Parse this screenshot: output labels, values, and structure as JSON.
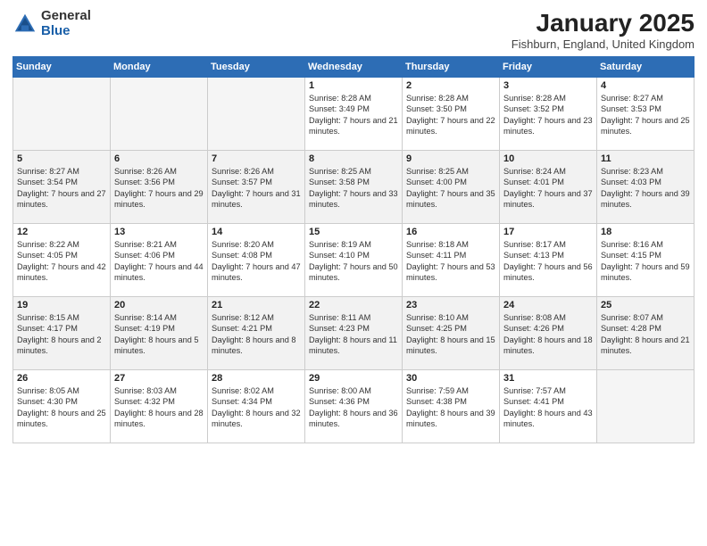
{
  "logo": {
    "general": "General",
    "blue": "Blue"
  },
  "title": "January 2025",
  "subtitle": "Fishburn, England, United Kingdom",
  "days_of_week": [
    "Sunday",
    "Monday",
    "Tuesday",
    "Wednesday",
    "Thursday",
    "Friday",
    "Saturday"
  ],
  "weeks": [
    [
      {
        "num": "",
        "info": ""
      },
      {
        "num": "",
        "info": ""
      },
      {
        "num": "",
        "info": ""
      },
      {
        "num": "1",
        "info": "Sunrise: 8:28 AM\nSunset: 3:49 PM\nDaylight: 7 hours\nand 21 minutes."
      },
      {
        "num": "2",
        "info": "Sunrise: 8:28 AM\nSunset: 3:50 PM\nDaylight: 7 hours\nand 22 minutes."
      },
      {
        "num": "3",
        "info": "Sunrise: 8:28 AM\nSunset: 3:52 PM\nDaylight: 7 hours\nand 23 minutes."
      },
      {
        "num": "4",
        "info": "Sunrise: 8:27 AM\nSunset: 3:53 PM\nDaylight: 7 hours\nand 25 minutes."
      }
    ],
    [
      {
        "num": "5",
        "info": "Sunrise: 8:27 AM\nSunset: 3:54 PM\nDaylight: 7 hours\nand 27 minutes."
      },
      {
        "num": "6",
        "info": "Sunrise: 8:26 AM\nSunset: 3:56 PM\nDaylight: 7 hours\nand 29 minutes."
      },
      {
        "num": "7",
        "info": "Sunrise: 8:26 AM\nSunset: 3:57 PM\nDaylight: 7 hours\nand 31 minutes."
      },
      {
        "num": "8",
        "info": "Sunrise: 8:25 AM\nSunset: 3:58 PM\nDaylight: 7 hours\nand 33 minutes."
      },
      {
        "num": "9",
        "info": "Sunrise: 8:25 AM\nSunset: 4:00 PM\nDaylight: 7 hours\nand 35 minutes."
      },
      {
        "num": "10",
        "info": "Sunrise: 8:24 AM\nSunset: 4:01 PM\nDaylight: 7 hours\nand 37 minutes."
      },
      {
        "num": "11",
        "info": "Sunrise: 8:23 AM\nSunset: 4:03 PM\nDaylight: 7 hours\nand 39 minutes."
      }
    ],
    [
      {
        "num": "12",
        "info": "Sunrise: 8:22 AM\nSunset: 4:05 PM\nDaylight: 7 hours\nand 42 minutes."
      },
      {
        "num": "13",
        "info": "Sunrise: 8:21 AM\nSunset: 4:06 PM\nDaylight: 7 hours\nand 44 minutes."
      },
      {
        "num": "14",
        "info": "Sunrise: 8:20 AM\nSunset: 4:08 PM\nDaylight: 7 hours\nand 47 minutes."
      },
      {
        "num": "15",
        "info": "Sunrise: 8:19 AM\nSunset: 4:10 PM\nDaylight: 7 hours\nand 50 minutes."
      },
      {
        "num": "16",
        "info": "Sunrise: 8:18 AM\nSunset: 4:11 PM\nDaylight: 7 hours\nand 53 minutes."
      },
      {
        "num": "17",
        "info": "Sunrise: 8:17 AM\nSunset: 4:13 PM\nDaylight: 7 hours\nand 56 minutes."
      },
      {
        "num": "18",
        "info": "Sunrise: 8:16 AM\nSunset: 4:15 PM\nDaylight: 7 hours\nand 59 minutes."
      }
    ],
    [
      {
        "num": "19",
        "info": "Sunrise: 8:15 AM\nSunset: 4:17 PM\nDaylight: 8 hours\nand 2 minutes."
      },
      {
        "num": "20",
        "info": "Sunrise: 8:14 AM\nSunset: 4:19 PM\nDaylight: 8 hours\nand 5 minutes."
      },
      {
        "num": "21",
        "info": "Sunrise: 8:12 AM\nSunset: 4:21 PM\nDaylight: 8 hours\nand 8 minutes."
      },
      {
        "num": "22",
        "info": "Sunrise: 8:11 AM\nSunset: 4:23 PM\nDaylight: 8 hours\nand 11 minutes."
      },
      {
        "num": "23",
        "info": "Sunrise: 8:10 AM\nSunset: 4:25 PM\nDaylight: 8 hours\nand 15 minutes."
      },
      {
        "num": "24",
        "info": "Sunrise: 8:08 AM\nSunset: 4:26 PM\nDaylight: 8 hours\nand 18 minutes."
      },
      {
        "num": "25",
        "info": "Sunrise: 8:07 AM\nSunset: 4:28 PM\nDaylight: 8 hours\nand 21 minutes."
      }
    ],
    [
      {
        "num": "26",
        "info": "Sunrise: 8:05 AM\nSunset: 4:30 PM\nDaylight: 8 hours\nand 25 minutes."
      },
      {
        "num": "27",
        "info": "Sunrise: 8:03 AM\nSunset: 4:32 PM\nDaylight: 8 hours\nand 28 minutes."
      },
      {
        "num": "28",
        "info": "Sunrise: 8:02 AM\nSunset: 4:34 PM\nDaylight: 8 hours\nand 32 minutes."
      },
      {
        "num": "29",
        "info": "Sunrise: 8:00 AM\nSunset: 4:36 PM\nDaylight: 8 hours\nand 36 minutes."
      },
      {
        "num": "30",
        "info": "Sunrise: 7:59 AM\nSunset: 4:38 PM\nDaylight: 8 hours\nand 39 minutes."
      },
      {
        "num": "31",
        "info": "Sunrise: 7:57 AM\nSunset: 4:41 PM\nDaylight: 8 hours\nand 43 minutes."
      },
      {
        "num": "",
        "info": ""
      }
    ]
  ]
}
